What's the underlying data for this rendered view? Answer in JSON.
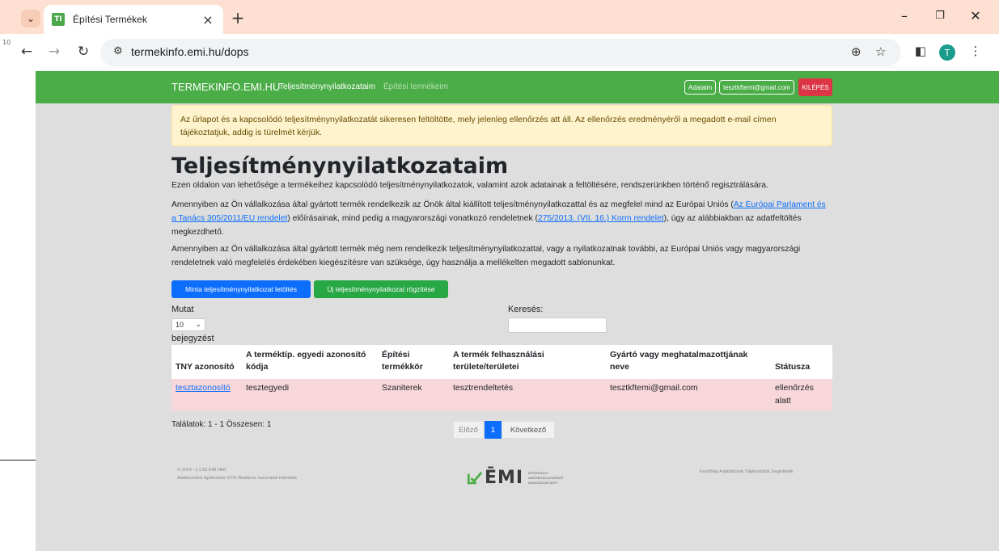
{
  "browser": {
    "tab_title": "Építési Termékek",
    "favicon_text": "TI",
    "url": "termekinfo.emi.hu/dops",
    "profile_initial": "T",
    "left_margin_number": "10"
  },
  "navbar": {
    "brand": "TERMEKINFO.EMI.HU",
    "link_active": "Teljesítménynyilatkozataim",
    "link_muted": "Építési termékeim",
    "my_data": "Adataim",
    "email": "tesztkftemi@gmail.com",
    "logout": "KILÉPÉS"
  },
  "alert": {
    "text": "Az űrlapot és a kapcsolódó teljesítménynyilatkozatát sikeresen feltöltötte, mely jelenleg ellenőrzés att áll. Az ellenőrzés eredményéről a megadott e-mail címen tájékoztatjuk, addig is türelmét kérjük."
  },
  "page": {
    "title": "Teljesítménynyilatkozataim",
    "intro": "Ezen oldalon van lehetősége a termékeihez kapcsolódó teljesítménynyilatkozatok, valamint azok adatainak a feltöltésére, rendszerünkben történő regisztrálására.",
    "p2_before": "Amennyiben az Ön vállalkozása által gyártott termék rendelkezik az Önök által kiállított teljesítménynyilatkozattal és az megfelel mind az Európai Uniós (",
    "p2_link1": "Az Európai Parlament és a Tanács 305/2011/EU rendelet",
    "p2_middle": ") előírásainak, mind pedig a magyarországi vonatkozó rendeletnek (",
    "p2_link2": "275/2013. (VII. 16.) Korm rendelet",
    "p2_after": "), úgy az alábbiakban az adatfeltöltés megkezdhető.",
    "p3": "Amennyiben az Ön vállalkozása által gyártott termék még nem rendelkezik teljesítménynyilatkozattal, vagy a nyilatkozatnak további, az Európai Uniós vagy magyarországi rendeletnek való megfelelés érdekében kiegészítésre van szüksége, úgy használja a mellékelten megadott sablonunkat."
  },
  "buttons": {
    "download_template": "Minta teljesítménynyilatkozat letöltés",
    "new_declaration": "Új teljesítménynyilatkozat rögzítése"
  },
  "table_controls": {
    "show_label": "Mutat",
    "page_size": "10",
    "entries_label": "bejegyzést",
    "search_label": "Keresés:"
  },
  "table": {
    "headers": {
      "c1": "TNY azonosító",
      "c2a": "A terméktíp. egyedi azonosító",
      "c2b": "kódja",
      "c3a": "Építési",
      "c3b": "termékkör",
      "c4a": "A termék felhasználási",
      "c4b": "területe/területei",
      "c5a": "Gyártó vagy meghatalmazottjának",
      "c5b": "neve",
      "c6": "Státusza"
    },
    "row": {
      "id": "tesztazonosító",
      "code": "tesztegyedi",
      "group": "Szaniterek",
      "usage": "tesztrendeltetés",
      "manufacturer": "tesztkftemi@gmail.com",
      "status_a": "ellenőrzés",
      "status_b": "alatt"
    }
  },
  "pagination": {
    "results": "Találatok: 1 - 1 Összesen: 1",
    "prev": "Előző",
    "current": "1",
    "next": "Következő"
  },
  "footer": {
    "copyright": "© 2024 - v.1.50 ÉMI Nkft.",
    "links_left": "Adatkezelési tájékoztató   GYIK   Általános használati feltételek",
    "logo_text": "ĒMI",
    "logo_sub1": "ÉPÍTÉSÜGYI",
    "logo_sub2": "MINŐSÉGELLENŐRZŐ",
    "logo_sub3": "INNOVÁCIÓS NKFT.",
    "links_right": "Kezdőlap   Adatbázisok   Tájékoztatók   Segédletek",
    "brand_colors": {
      "green": "#4bad47",
      "dark": "#3a3a3a"
    }
  }
}
